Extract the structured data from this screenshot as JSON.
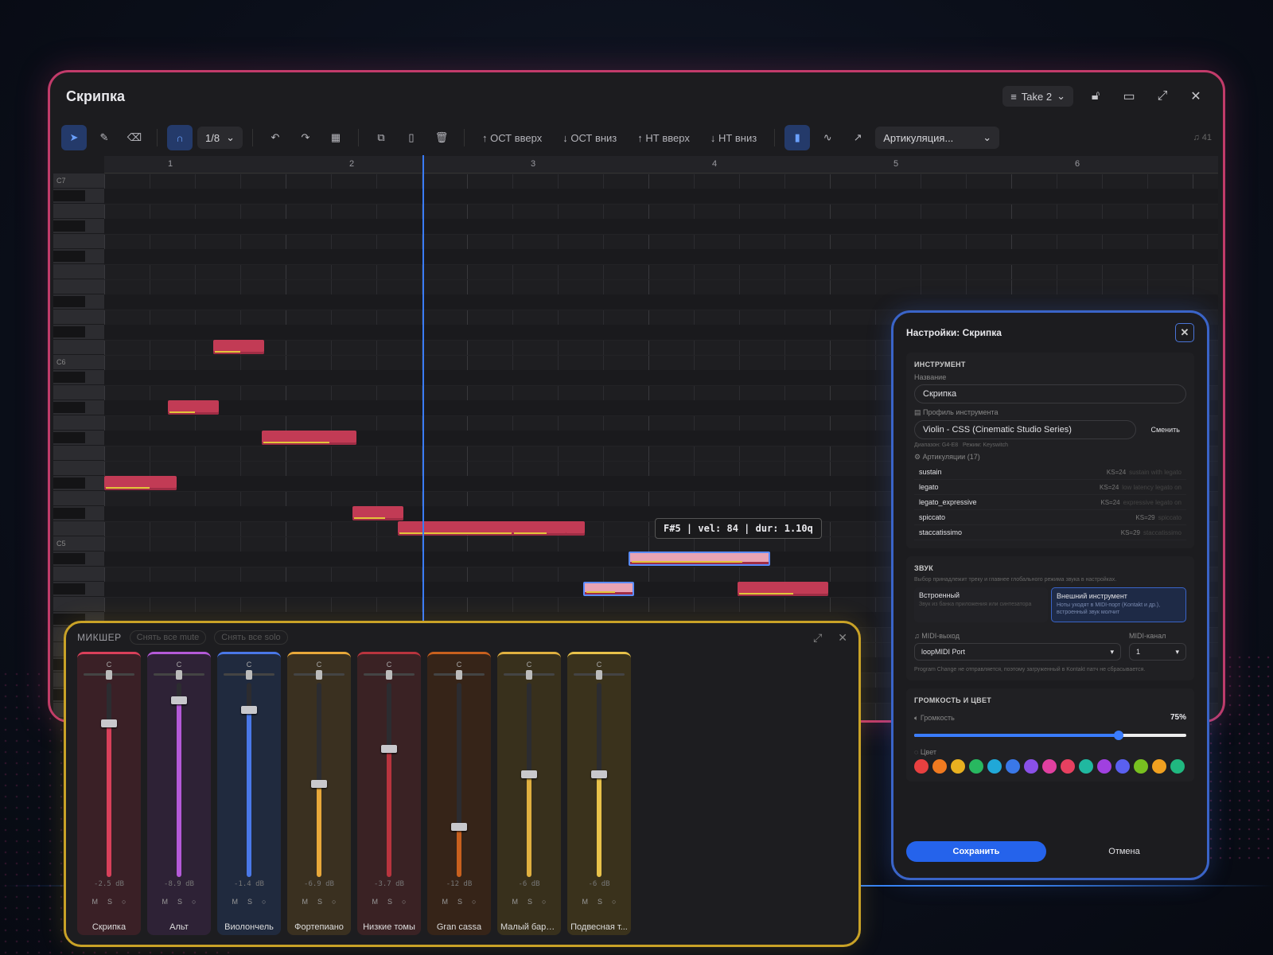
{
  "window": {
    "title": "Скрипка",
    "take": "Take 2"
  },
  "toolbar": {
    "quantize": "1/8",
    "oct_up": "ОСТ вверх",
    "oct_down": "ОСТ вниз",
    "nt_up": "НТ вверх",
    "nt_down": "НТ вниз",
    "articulation": "Артикуляция...",
    "counter": "41"
  },
  "ruler": [
    "1",
    "2",
    "3",
    "4",
    "5",
    "6"
  ],
  "piano": {
    "labels": [
      "C7",
      "C6",
      "C5"
    ]
  },
  "notes": [
    {
      "bar": 1.0,
      "len": 0.4,
      "row": 20,
      "vel": 0.6
    },
    {
      "bar": 1.35,
      "len": 0.28,
      "row": 15,
      "vel": 0.5
    },
    {
      "bar": 1.6,
      "len": 0.28,
      "row": 11,
      "vel": 0.5
    },
    {
      "bar": 1.87,
      "len": 0.52,
      "row": 17,
      "vel": 0.7
    },
    {
      "bar": 2.37,
      "len": 0.28,
      "row": 22,
      "vel": 0.6
    },
    {
      "bar": 2.62,
      "len": 1.03,
      "row": 23,
      "vel": 0.6
    },
    {
      "bar": 3.25,
      "len": 0.3,
      "row": 23,
      "vel": 0.6
    },
    {
      "bar": 3.64,
      "len": 0.28,
      "row": 27,
      "vel": 0.6,
      "sel": true
    },
    {
      "bar": 3.89,
      "len": 0.78,
      "row": 25,
      "vel": 0.8,
      "sel": true
    },
    {
      "bar": 4.24,
      "len": 0.28,
      "row": 32,
      "vel": 0.6
    },
    {
      "bar": 4.49,
      "len": 0.5,
      "row": 27,
      "vel": 0.6
    }
  ],
  "tooltip": "F#5 | vel: 84 | dur: 1.10q",
  "mixer": {
    "title": "МИКШЕР",
    "mute_all": "Снять все mute",
    "solo_all": "Снять все solo",
    "pan": "C",
    "m": "M",
    "s": "S",
    "tracks": [
      {
        "name": "Скрипка",
        "db": "-2.5 dB",
        "level": 0.79,
        "color": "#d8405a",
        "bg": "#3a2026"
      },
      {
        "name": "Альт",
        "db": "-8.9 dB",
        "level": 0.91,
        "color": "#b45ad8",
        "bg": "#2e2236"
      },
      {
        "name": "Виолончель",
        "db": "-1.4 dB",
        "level": 0.86,
        "color": "#4a78e8",
        "bg": "#202a3e"
      },
      {
        "name": "Фортепиано",
        "db": "-6.9 dB",
        "level": 0.48,
        "color": "#e8a83a",
        "bg": "#3a3020"
      },
      {
        "name": "Низкие томы",
        "db": "-3.7 dB",
        "level": 0.66,
        "color": "#b8343e",
        "bg": "#3a2224"
      },
      {
        "name": "Gran cassa",
        "db": "-12 dB",
        "level": 0.26,
        "color": "#c8601e",
        "bg": "#362418"
      },
      {
        "name": "Малый бара...",
        "db": "-6 dB",
        "level": 0.53,
        "color": "#e0b040",
        "bg": "#38301c"
      },
      {
        "name": "Подвесная т...",
        "db": "-6 dB",
        "level": 0.53,
        "color": "#e8c24a",
        "bg": "#3a321c"
      }
    ]
  },
  "settings": {
    "title": "Настройки: Скрипка",
    "instrument": {
      "section": "ИНСТРУМЕНТ",
      "name_label": "Название",
      "name": "Скрипка",
      "profile_label": "Профиль инструмента",
      "profile": "Violin - CSS (Cinematic Studio Series)",
      "change": "Сменить",
      "range": "Диапазон: G4-E8",
      "mode": "Режим: Keyswitch"
    },
    "articulations": {
      "label": "Артикуляции (17)",
      "items": [
        {
          "name": "sustain",
          "ks": "KS=24",
          "desc": "sustain with legato"
        },
        {
          "name": "legato",
          "ks": "KS=24",
          "desc": "low latency legato on"
        },
        {
          "name": "legato_expressive",
          "ks": "KS=24",
          "desc": "expressive legato on"
        },
        {
          "name": "spiccato",
          "ks": "KS=29",
          "desc": "spiccato"
        },
        {
          "name": "staccatissimo",
          "ks": "KS=29",
          "desc": "staccatissimo"
        }
      ]
    },
    "sound": {
      "section": "ЗВУК",
      "desc": "Выбор принадлежит треку и главнее глобального режима звука в настройках.",
      "builtin": "Встроенный",
      "builtin_desc": "Звук из банка приложения или синтезатора",
      "external": "Внешний инструмент",
      "external_desc": "Ноты уходят в MIDI-порт (Kontakt и др.), встроенный звук молчит",
      "midi_out_label": "MIDI-выход",
      "midi_out": "loopMIDI Port",
      "midi_ch_label": "MIDI-канал",
      "midi_ch": "1",
      "note": "Program Change не отправляется, поэтому загруженный в Kontakt патч не сбрасывается."
    },
    "volume": {
      "section": "ГРОМКОСТЬ И ЦВЕТ",
      "label": "Громкость",
      "value": "75%",
      "level": 0.75,
      "color_label": "Цвет",
      "colors": [
        "#e84040",
        "#f07a20",
        "#e8b020",
        "#28b860",
        "#20a8d8",
        "#3a78e8",
        "#8a50e8",
        "#e040a0",
        "#e84060",
        "#20b8a0",
        "#a040e0",
        "#5a60f0",
        "#78c020",
        "#f0a020",
        "#20b880"
      ]
    },
    "save": "Сохранить",
    "cancel": "Отмена"
  }
}
